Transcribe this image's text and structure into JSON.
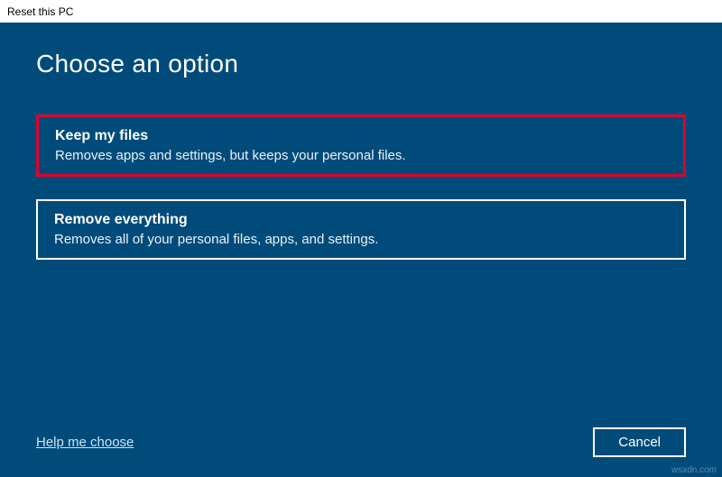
{
  "window": {
    "title": "Reset this PC"
  },
  "heading": "Choose an option",
  "options": [
    {
      "title": "Keep my files",
      "description": "Removes apps and settings, but keeps your personal files.",
      "highlighted": true
    },
    {
      "title": "Remove everything",
      "description": "Removes all of your personal files, apps, and settings.",
      "highlighted": false
    }
  ],
  "footer": {
    "help_link": "Help me choose",
    "cancel_label": "Cancel"
  },
  "watermark": "wsxdn.com"
}
